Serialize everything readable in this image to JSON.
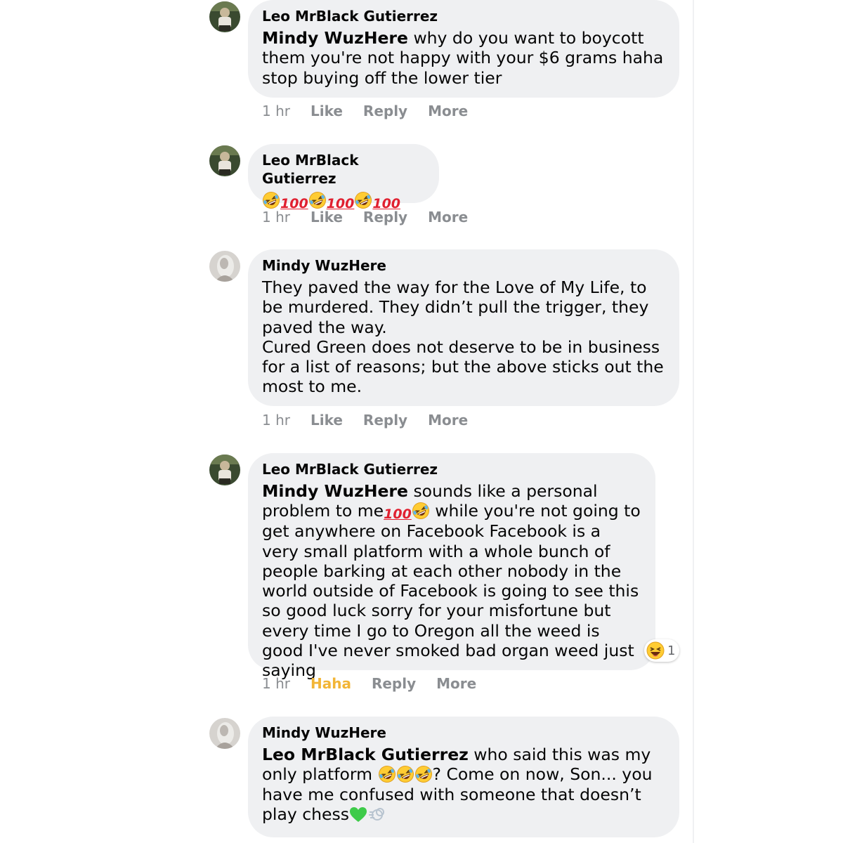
{
  "comments": [
    {
      "author": "Leo MrBlack Gutierrez",
      "mention": "Mindy WuzHere",
      "text": " why do you want to boycott them you're not happy with your $6 grams haha stop buying off the lower tier",
      "time": "1 hr",
      "like": "Like",
      "reply": "Reply",
      "more": "More"
    },
    {
      "author": "Leo MrBlack Gutierrez",
      "emoji_sequence": [
        "rofl",
        "100",
        "rofl",
        "100",
        "rofl",
        "100"
      ],
      "time": "1 hr",
      "like": "Like",
      "reply": "Reply",
      "more": "More"
    },
    {
      "author": "Mindy WuzHere",
      "line1": "They paved the way for the Love of My Life, to be murdered. They didn’t pull the trigger, they paved the way.",
      "line2": "Cured Green does not deserve to be in business for a list of reasons; but the above sticks out the most to me.",
      "time": "1 hr",
      "like": "Like",
      "reply": "Reply",
      "more": "More"
    },
    {
      "author": "Leo MrBlack Gutierrez",
      "mention": "Mindy WuzHere",
      "text_a": " sounds like a personal problem to me",
      "text_b": " while you're not going to get anywhere on Facebook Facebook is a very small platform with a whole bunch of people barking at each other nobody in the world outside of Facebook is going to see this so good luck sorry for your misfortune but every time I go to Oregon all the weed is good I've never smoked bad organ weed just saying",
      "reaction_count": "1",
      "time": "1 hr",
      "like": "Haha",
      "reply": "Reply",
      "more": "More"
    },
    {
      "author": "Mindy WuzHere",
      "mention": "Leo MrBlack Gutierrez",
      "text_a": " who said this was my only platform ",
      "text_b": "? Come on now, Son... you have me confused with someone that doesn’t play chess"
    }
  ],
  "emoji_100": "100",
  "colors": {
    "bubble": "#eff0f2",
    "meta": "#8a8d91",
    "haha_active": "#f2b536",
    "hundred_red": "#e02030"
  },
  "icons": [
    "rofl-emoji",
    "hundred-points-emoji",
    "haha-reaction-icon",
    "green-heart-emoji",
    "dash-emoji"
  ]
}
